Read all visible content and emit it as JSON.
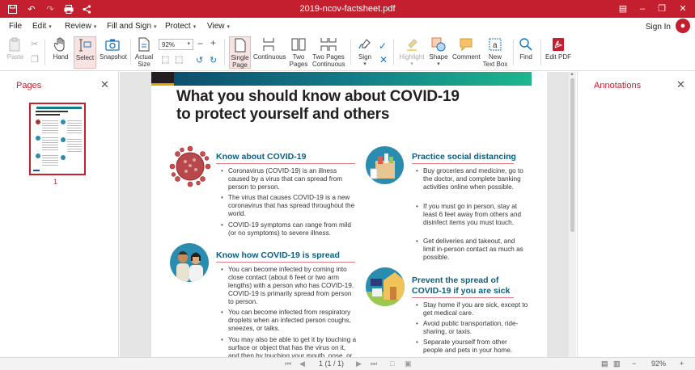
{
  "window": {
    "title": "2019-ncov-factsheet.pdf"
  },
  "menu": {
    "items": [
      "File",
      "Edit",
      "Review",
      "Fill and Sign",
      "Protect",
      "View"
    ],
    "sign_in": "Sign In"
  },
  "toolbar": {
    "paste": "Paste",
    "hand": "Hand",
    "select": "Select",
    "snapshot": "Snapshot",
    "actual_size": "Actual Size",
    "zoom_value": "92%",
    "single_page": "Single Page",
    "continuous": "Continuous",
    "two_pages": "Two Pages",
    "two_pages_continuous": "Two Pages Continuous",
    "sign": "Sign",
    "highlight": "Highlight",
    "shape": "Shape",
    "comment": "Comment",
    "new_text_box": "New Text Box",
    "find": "Find",
    "edit_pdf": "Edit PDF"
  },
  "left_panel": {
    "title": "Pages",
    "page_number": "1"
  },
  "right_panel": {
    "title": "Annotations"
  },
  "document": {
    "title_line1": "What you should know about COVID-19",
    "title_line2": "to protect yourself and others",
    "sections": {
      "know": {
        "heading": "Know about COVID-19",
        "bullets": [
          "Coronavirus (COVID-19) is an illness caused by a virus that can spread from person to person.",
          "The virus that causes COVID-19 is a new coronavirus that has spread throughout the world.",
          "COVID-19 symptoms can range from mild (or no symptoms) to severe illness."
        ]
      },
      "spread": {
        "heading": "Know how COVID-19 is spread",
        "bullets": [
          "You can become infected by coming into close contact (about 6 feet or two arm lengths) with a person who has COVID-19. COVID-19 is primarily spread from person to person.",
          "You can become infected from respiratory droplets when an infected person coughs, sneezes, or talks.",
          "You may also be able to get it by touching a surface or object that has the virus on it, and then by touching your mouth, nose, or eyes."
        ]
      },
      "distance": {
        "heading": "Practice social distancing",
        "bullets": [
          "Buy groceries and medicine, go to the doctor, and complete banking activities online when possible.",
          "If you must go in person, stay at least 6 feet away from others and disinfect items you must touch.",
          "Get deliveries and takeout, and limit in-person contact as much as possible."
        ]
      },
      "prevent": {
        "heading_line1": "Prevent the spread of",
        "heading_line2": "COVID-19 if you are sick",
        "bullets": [
          "Stay home if you are sick, except to get medical care.",
          "Avoid public transportation, ride-sharing, or taxis.",
          "Separate yourself from other people and pets in your home."
        ]
      }
    }
  },
  "status": {
    "page_indicator": "1 (1 / 1)",
    "zoom": "92%"
  },
  "colors": {
    "brand": "#c41f2f",
    "heading_teal": "#0e5e7d"
  }
}
